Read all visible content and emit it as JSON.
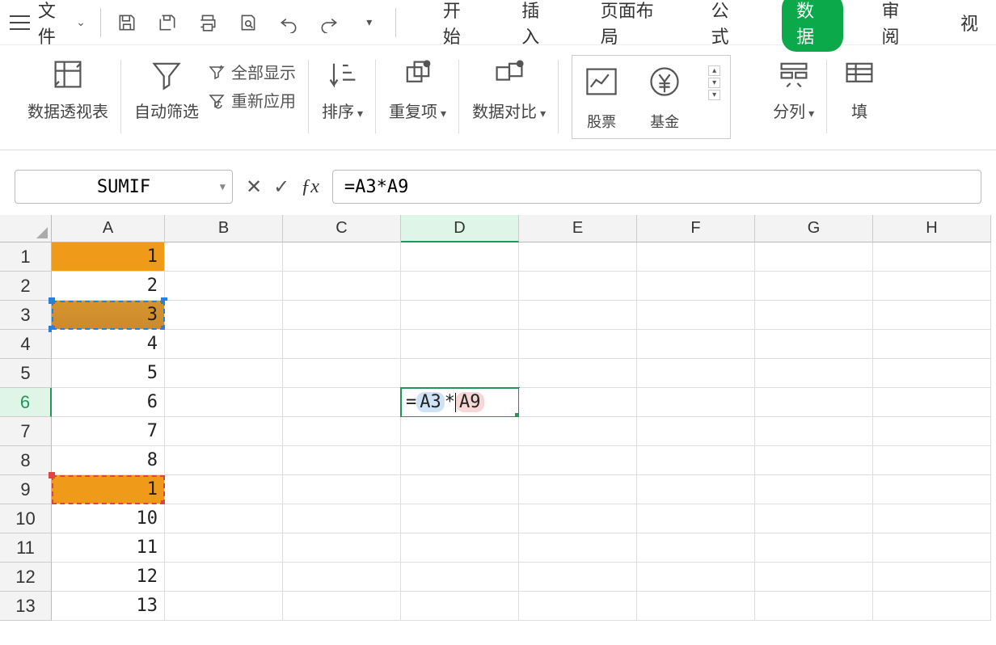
{
  "topbar": {
    "file_label": "文件"
  },
  "menu_tabs": [
    "开始",
    "插入",
    "页面布局",
    "公式",
    "数据",
    "审阅",
    "视"
  ],
  "active_menu_index": 4,
  "ribbon": {
    "pivot": "数据透视表",
    "autofilter": "自动筛选",
    "show_all": "全部显示",
    "reapply": "重新应用",
    "sort": "排序",
    "duplicates": "重复项",
    "compare": "数据对比",
    "stock": "股票",
    "fund": "基金",
    "split": "分列",
    "fill_partial": "填"
  },
  "formula_bar": {
    "name_box": "SUMIF",
    "formula": "=A3*A9"
  },
  "columns": [
    "A",
    "B",
    "C",
    "D",
    "E",
    "F",
    "G",
    "H"
  ],
  "rows": [
    {
      "n": 1,
      "A": "1"
    },
    {
      "n": 2,
      "A": "2"
    },
    {
      "n": 3,
      "A": "3"
    },
    {
      "n": 4,
      "A": "4"
    },
    {
      "n": 5,
      "A": "5"
    },
    {
      "n": 6,
      "A": "6",
      "D_editing": true
    },
    {
      "n": 7,
      "A": "7"
    },
    {
      "n": 8,
      "A": "8"
    },
    {
      "n": 9,
      "A": "1"
    },
    {
      "n": 10,
      "A": "10"
    },
    {
      "n": 11,
      "A": "11"
    },
    {
      "n": 12,
      "A": "12"
    },
    {
      "n": 13,
      "A": "13"
    }
  ],
  "editing_cell": {
    "prefix": "=",
    "ref1": "A3",
    "op": "*",
    "ref2": "A9"
  },
  "active_cell_ref": "D6",
  "marching_refs": [
    "A3",
    "A9"
  ]
}
